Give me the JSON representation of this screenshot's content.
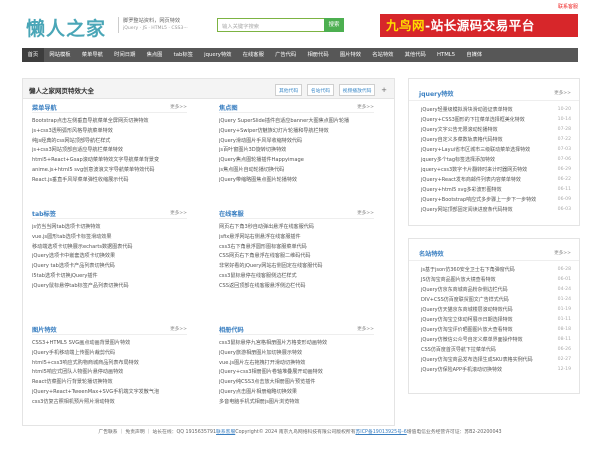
{
  "topbar": {
    "contact": "联系客服"
  },
  "header": {
    "logo": "懒人之家",
    "slogan": "脚罗整站资料，网页特效",
    "slogan_sub": "jQuery · JS · HTML5 · CSS3···",
    "search_placeholder": "输入关键字搜索",
    "search_button": "搜索",
    "banner_a": "九鸟网",
    "banner_b": "-站长源码交易平台"
  },
  "nav": [
    "首页",
    "网站模板",
    "菜单导航",
    "时间日期",
    "焦点图",
    "tab标签",
    "jquery特效",
    "在线客服",
    "广告代码",
    "相册代码",
    "图片特效",
    "名站特效",
    "其他代码",
    "HTML5",
    "自媒体"
  ],
  "left": {
    "title": "懒人之家网页特效大全",
    "tabs": [
      "其他代码",
      "名站代码",
      "视频播放代码",
      "+"
    ],
    "sections": [
      {
        "name": "菜单导航",
        "more": "更多>>",
        "items": [
          "Bootstrap点击左侧垂直导航菜单全屏网页切换特效",
          "js+css3透明弧形风格导航菜单特效",
          "纯js经典的css网站顶部导航栏样式",
          "js+css3网站顶部自适应导航栏菜单特效",
          "html5+React+Gsap滚动菜单特效文字导航菜单背景变",
          "anime.js+html5 svg创意波浪文字导航菜单特效代码",
          "React.js垂直手风琴菜单弹性收缩展示代码"
        ]
      },
      {
        "name": "焦点图",
        "more": "更多>>",
        "items": [
          "jQuery SuperSlide插件自适应banner大图焦点图片轮播",
          "jQuery+Swiper仿魅族幻灯片轮播和导航栏特效",
          "jQuery滑动图片手风琴收缩特效代码",
          "js百叶窗图片3D旋转切换特效",
          "jQuery焦点图轮播插件Happyimage",
          "js焦点图片自动轮播切换代码",
          "jQuery带缩略图焦点图片轮播特效"
        ]
      },
      {
        "name": "tab标签",
        "more": "更多>>",
        "items": [
          "js仿当当网tab选项卡切换特效",
          "vue.js圆形tab选项卡标签滑动效果",
          "移动端选项卡切换展示echarts数据图表代码",
          "jQuery选项卡中嵌套选项卡切换效果",
          "jQuery tab选项卡产品列表切换代码",
          "l5tab选项卡切换jQuery插件",
          "jQuery鼠标悬停tab标签产品列表切换代码"
        ]
      },
      {
        "name": "在线客服",
        "more": "更多>>",
        "items": [
          "网页右下角3秒自动弹出悬浮在线客服代码",
          "jsfix悬浮网站右侧悬浮在线客服插件",
          "css3右下角悬浮圆形图标客服菜单代码",
          "CSS网页右下角悬浮在线客服二维码代码",
          "非常好看的jQuery网站右侧固定在线客服代码",
          "css3鼠标悬停在线客服侧边栏样式",
          "CSS返回顶部在线客服悬浮侧边栏代码"
        ]
      },
      {
        "name": "图片特效",
        "more": "更多>>",
        "items": [
          "CSS3+HTML5 SVG画点动画背景图片特效",
          "jQuery手机移动端上传图片裁剪代码",
          "html5+css3响应式购物商城商品列表布局特效",
          "html5响应式团队人物图片悬停动画特效",
          "React仿菜图片行背景轮播切换特效",
          "jQuery+React+TweenMax+SVG手机端文字发散气泡",
          "css3仿复古照相机预片照片滑动特效"
        ]
      },
      {
        "name": "相册代码",
        "more": "更多>>",
        "items": [
          "css3鼠标悬停九宫格相册图片方格变形动画特效",
          "jQuery旅游相册图片加切换展示特效",
          "vue.js图片左右拖拽打开滑动切换特效",
          "jQuery+css3相册图片卷轴堆叠展开动画特效",
          "jQuery纯CSS3点击放大相册图片预览插件",
          "jQuery点击图片相册缩略切换效果",
          "多音电脑手机式相册js图片浏览特效"
        ]
      }
    ]
  },
  "right": {
    "boxes": [
      {
        "name": "jquery特效",
        "more": "更多>>",
        "items": [
          {
            "t": "jQuery轻量级模拟滑块滑动验证表单特效",
            "d": "10-20"
          },
          {
            "t": "jQuery+CSS3图形的下拉菜单选择框美化特效",
            "d": "10-14"
          },
          {
            "t": "jQuery文字公告无限滚动轮播特效",
            "d": "07-28"
          },
          {
            "t": "jQuery自定义多菜数轨表格代码特效",
            "d": "07-22"
          },
          {
            "t": "jQuery+Layui省市区城市三级联动菜单选择特效",
            "d": "07-03"
          },
          {
            "t": "jquery多个tag标签选择添加特效",
            "d": "07-06"
          },
          {
            "t": "jquery+css3数字卡片翻转时来计时器网页特效",
            "d": "06-29"
          },
          {
            "t": "jQuery+React发布商邮件列表内容菜单特效",
            "d": "06-22"
          },
          {
            "t": "jQuery+html5 svg多彩波形图特效",
            "d": "06-11"
          },
          {
            "t": "jQuery+Bootstrap响应式多步骤上一步下一步特效",
            "d": "06-09"
          },
          {
            "t": "jQuery网站顶部固定阅读进度条代码特效",
            "d": "06-03"
          }
        ]
      },
      {
        "name": "名站特效",
        "more": "更多>>",
        "items": [
          {
            "t": "js基于json仿360安全卫士右下角弹窗代码",
            "d": "06-28"
          },
          {
            "t": "JS仿淘宝商品图片放大镜查看特效",
            "d": "06-01"
          },
          {
            "t": "jQuery仿京东商城商品粉杂侧边栏代码",
            "d": "04-24"
          },
          {
            "t": "DIV+CSS仿百度联贸图文广告样式代码",
            "d": "01-24"
          },
          {
            "t": "jQuery仿天猫京东商城楼层滚动特效代码",
            "d": "01-19"
          },
          {
            "t": "jQuery仿淘宝立体动柯展示日期选择特效",
            "d": "01-11"
          },
          {
            "t": "jQuery仿淘宝评价晒图图片放大查看特效",
            "d": "08-18"
          },
          {
            "t": "jQuery仿微信公众号自定义菜单界面操作特效",
            "d": "08-11"
          },
          {
            "t": "CSS仿百度首页导航下拉菜单代码",
            "d": "06-26"
          },
          {
            "t": "jQuery仿淘宝商品发布选择生成SKU表格实例代码",
            "d": "02-27"
          },
          {
            "t": "jQuery仿保险APP手机滚动切换特效",
            "d": "12-19"
          }
        ]
      }
    ]
  },
  "footer": {
    "pre": "广告联系 ｜ 免责声明 ｜ 站长在线：QQ 1915635791",
    "link1": "联系客服",
    "mid": "Copyright© 2024 南京九鸟网络科技有限公司版权所有",
    "link2": "苏ICP备19013925号-6",
    "post": "增值电信业务经营许可证：苏B2-20200043"
  }
}
